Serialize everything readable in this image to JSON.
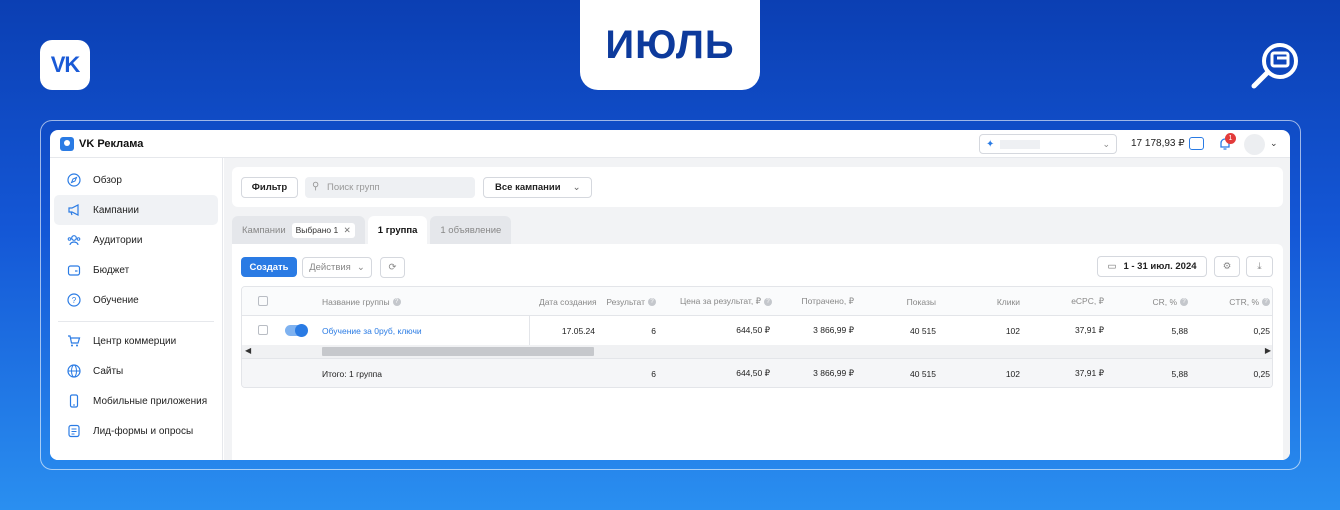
{
  "hero": {
    "logo": "VK",
    "month": "ИЮЛЬ",
    "badge_icon": "ads-search-icon"
  },
  "app": {
    "brand": "VK Реклама",
    "account_selector": {
      "prefix": "✦",
      "chevron": "⌄"
    },
    "balance": "17 178,93 ₽",
    "notifications_count": "1"
  },
  "sidebar": {
    "items": [
      {
        "label": "Обзор",
        "icon": "compass-icon"
      },
      {
        "label": "Кампании",
        "icon": "megaphone-icon"
      },
      {
        "label": "Аудитории",
        "icon": "users-icon"
      },
      {
        "label": "Бюджет",
        "icon": "wallet-icon"
      },
      {
        "label": "Обучение",
        "icon": "help-icon"
      },
      {
        "label": "Центр коммерции",
        "icon": "cart-icon"
      },
      {
        "label": "Сайты",
        "icon": "globe-icon"
      },
      {
        "label": "Мобильные приложения",
        "icon": "phone-icon"
      },
      {
        "label": "Лид-формы и опросы",
        "icon": "form-icon"
      }
    ]
  },
  "filterbar": {
    "filter_label": "Фильтр",
    "search_placeholder": "Поиск групп",
    "campaigns_select": "Все кампании"
  },
  "tabs": {
    "campaigns": "Кампании",
    "selected_chip": "Выбрано 1",
    "groups": "1 группа",
    "ads": "1 объявление"
  },
  "toolbar": {
    "create": "Создать",
    "actions": "Действия",
    "date_range": "1 - 31 июл. 2024"
  },
  "table": {
    "headers": {
      "name": "Название группы",
      "created": "Дата создания",
      "result": "Результат",
      "cost_per_result": "Цена за результат, ₽",
      "spent": "Потрачено, ₽",
      "impressions": "Показы",
      "clicks": "Клики",
      "ecpc": "eCPC, ₽",
      "cr": "CR, %",
      "ctr": "CTR, %"
    },
    "row": {
      "name": "Обучение за 0руб, ключи",
      "created": "17.05.24",
      "result": "6",
      "cost_per_result": "644,50 ₽",
      "spent": "3 866,99 ₽",
      "impressions": "40 515",
      "clicks": "102",
      "ecpc": "37,91 ₽",
      "cr": "5,88",
      "ctr": "0,25"
    },
    "total": {
      "name": "Итого: 1 группа",
      "result": "6",
      "cost_per_result": "644,50 ₽",
      "spent": "3 866,99 ₽",
      "impressions": "40 515",
      "clicks": "102",
      "ecpc": "37,91 ₽",
      "cr": "5,88",
      "ctr": "0,25"
    }
  },
  "colors": {
    "accent": "#2a7be4",
    "bg_top": "#0b3fb3",
    "bg_bottom": "#2a8ff0"
  }
}
